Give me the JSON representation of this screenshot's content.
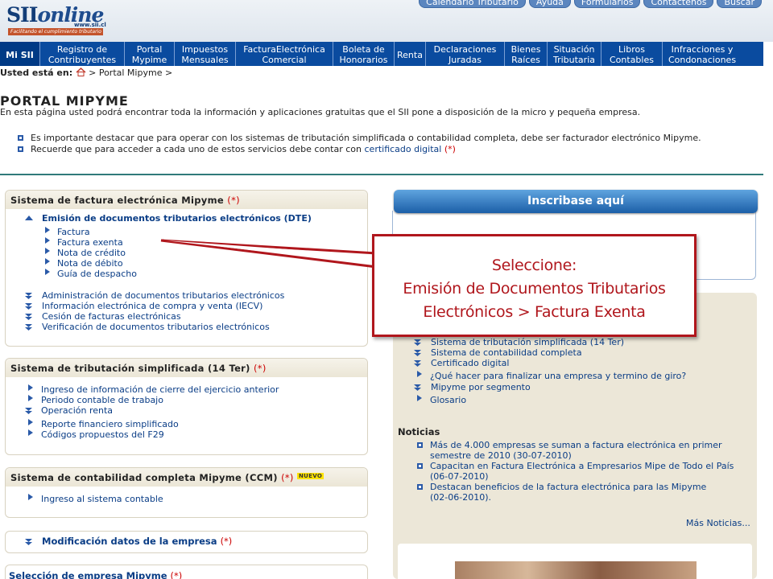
{
  "header": {
    "logo_text": "SII",
    "logo_brand": "online",
    "logo_url": "www.sii.cl",
    "logo_tagline": "Facilitando el cumplimiento tributario",
    "top_links": [
      "Calendario Tributario",
      "Ayuda",
      "Formularios",
      "Contáctenos",
      "Buscar"
    ]
  },
  "nav": [
    "Mi SII",
    "Registro de Contribuyentes",
    "Portal Mypime",
    "Impuestos Mensuales",
    "FacturaElectrónica Comercial",
    "Boleta de Honorarios",
    "Renta",
    "Declaraciones Juradas",
    "Bienes Raíces",
    "Situación Tributaria",
    "Libros Contables",
    "Infracciones y Condonaciones"
  ],
  "breadcrumb": {
    "label": "Usted está en:",
    "path": " > Portal Mipyme >"
  },
  "page_title": "PORTAL MIPYME",
  "intro": "En esta página usted podrá encontrar toda la información y aplicaciones gratuitas que el SII pone a disposición de la micro y pequeña empresa.",
  "bullets": {
    "b1": "Es importante destacar que para operar con los sistemas de tributación simplificada o contabilidad completa, debe ser facturador electrónico Mipyme.",
    "b2_text": "Recuerde que para acceder a cada uno de estos servicios debe contar con ",
    "b2_link": "certificado digital",
    "b2_ast": "(*)"
  },
  "panel_factura": {
    "title": "Sistema de factura electrónica Mipyme",
    "ast": "(*)",
    "expanded": "Emisión de documentos tributarios electrónicos (DTE)",
    "subitems": [
      "Factura",
      "Factura exenta",
      "Nota de crédito",
      "Nota de débito",
      "Guía de despacho"
    ],
    "items": [
      "Administración de documentos tributarios electrónicos",
      "Información electrónica de compra y venta (IECV)",
      "Cesión de facturas electrónicas",
      "Verificación de documentos tributarios electrónicos"
    ]
  },
  "panel_14ter": {
    "title": "Sistema de tributación simplificada (14 Ter)",
    "ast": "(*)",
    "items": [
      "Ingreso de información de cierre del ejercicio anterior",
      "Periodo contable de trabajo",
      "Operación renta",
      "Reporte financiero simplificado",
      "Códigos propuestos del F29"
    ]
  },
  "panel_ccm": {
    "title": "Sistema de contabilidad completa Mipyme (CCM)",
    "ast": "(*)",
    "badge": "NUEVO",
    "items": [
      "Ingreso al sistema  contable"
    ]
  },
  "panel_modificacion": {
    "title": "Modificación datos de la empresa",
    "ast": "(*)"
  },
  "panel_seleccion": {
    "title": "Selección de empresa Mipyme",
    "ast": "(*)"
  },
  "right": {
    "inscribase": "Inscribase aquí",
    "links": [
      "Sistema de tributación simplificada (14 Ter)",
      "Sistema de contabilidad completa",
      "Certificado digital",
      "¿Qué hacer para finalizar una empresa y termino de giro?",
      "Mipyme por segmento",
      "Glosario"
    ],
    "noticias_title": "Noticias",
    "noticias": [
      [
        "Más de 4.000 empresas se suman a factura electrónica en primer",
        "semestre de 2010 (30-07-2010)"
      ],
      [
        "Capacitan en Factura Electrónica a Empresarios Mipe de Todo el País",
        "(06-07-2010)"
      ],
      [
        "Destacan beneficios de la factura electrónica para las Mipyme",
        "(02-06-2010)."
      ]
    ],
    "mas_noticias": "Más Noticias..."
  },
  "callout": {
    "line1": "Seleccione:",
    "line2": "Emisión de Documentos Tributarios",
    "line3": "Electrónicos > Factura Exenta"
  },
  "colors": {
    "nav_blue": "#0a4b9f",
    "callout_red": "#b0161c",
    "link_blue": "#0a3d86"
  }
}
